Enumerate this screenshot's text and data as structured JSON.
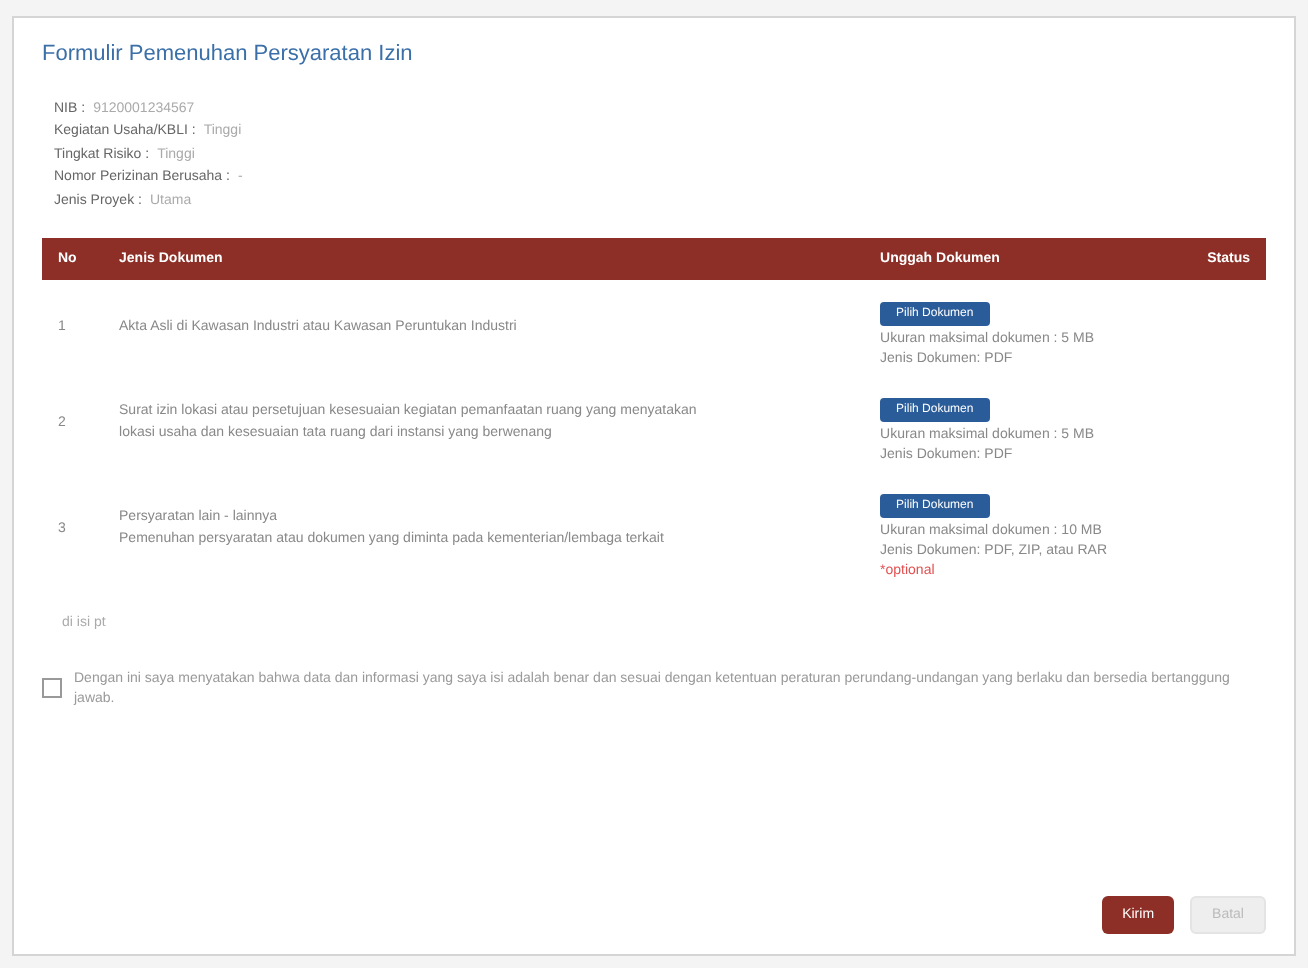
{
  "title": "Formulir Pemenuhan Persyaratan Izin",
  "info": [
    {
      "label": "NIB :",
      "value": "9120001234567"
    },
    {
      "label": "Kegiatan Usaha/KBLI :",
      "value": "Tinggi"
    },
    {
      "label": "Tingkat Risiko :",
      "value": "Tinggi"
    },
    {
      "label": "Nomor Perizinan Berusaha :",
      "value": "-"
    },
    {
      "label": "Jenis Proyek :",
      "value": "Utama"
    }
  ],
  "table": {
    "columns": [
      "No",
      "Jenis Dokumen",
      "Unggah Dokumen",
      "Status"
    ],
    "rows": [
      {
        "no": "1",
        "document": "Akta Asli di Kawasan Industri atau Kawasan Peruntukan Industri",
        "button": "Pilih Dokumen",
        "notes": [
          "Ukuran maksimal dokumen : 5 MB",
          "Jenis Dokumen: PDF"
        ],
        "optional": false
      },
      {
        "no": "2",
        "document": "Surat izin lokasi atau persetujuan kesesuaian kegiatan pemanfaatan ruang yang menyatakan lokasi usaha dan kesesuaian tata ruang dari instansi yang berwenang",
        "button": "Pilih Dokumen",
        "notes": [
          "Ukuran maksimal dokumen : 5 MB",
          "Jenis Dokumen: PDF"
        ],
        "optional": false
      },
      {
        "no": "3",
        "document": "Persyaratan lain - lainnya\nPemenuhan persyaratan atau dokumen yang diminta pada kementerian/lembaga terkait",
        "button": "Pilih Dokumen",
        "notes": [
          "Ukuran maksimal dokumen : 10 MB",
          "Jenis Dokumen: PDF, ZIP, atau RAR"
        ],
        "optional": true,
        "optional_text": "*optional"
      }
    ]
  },
  "note": "di isi pt",
  "agreement": {
    "checked": false,
    "text": "Dengan ini saya menyatakan bahwa data dan informasi yang saya isi adalah benar dan sesuai dengan ketentuan peraturan perundang-undangan yang berlaku dan bersedia bertanggung jawab."
  },
  "buttons": [
    {
      "label": "Kirim",
      "kind": "primary"
    },
    {
      "label": "Batal",
      "kind": "secondary"
    }
  ]
}
